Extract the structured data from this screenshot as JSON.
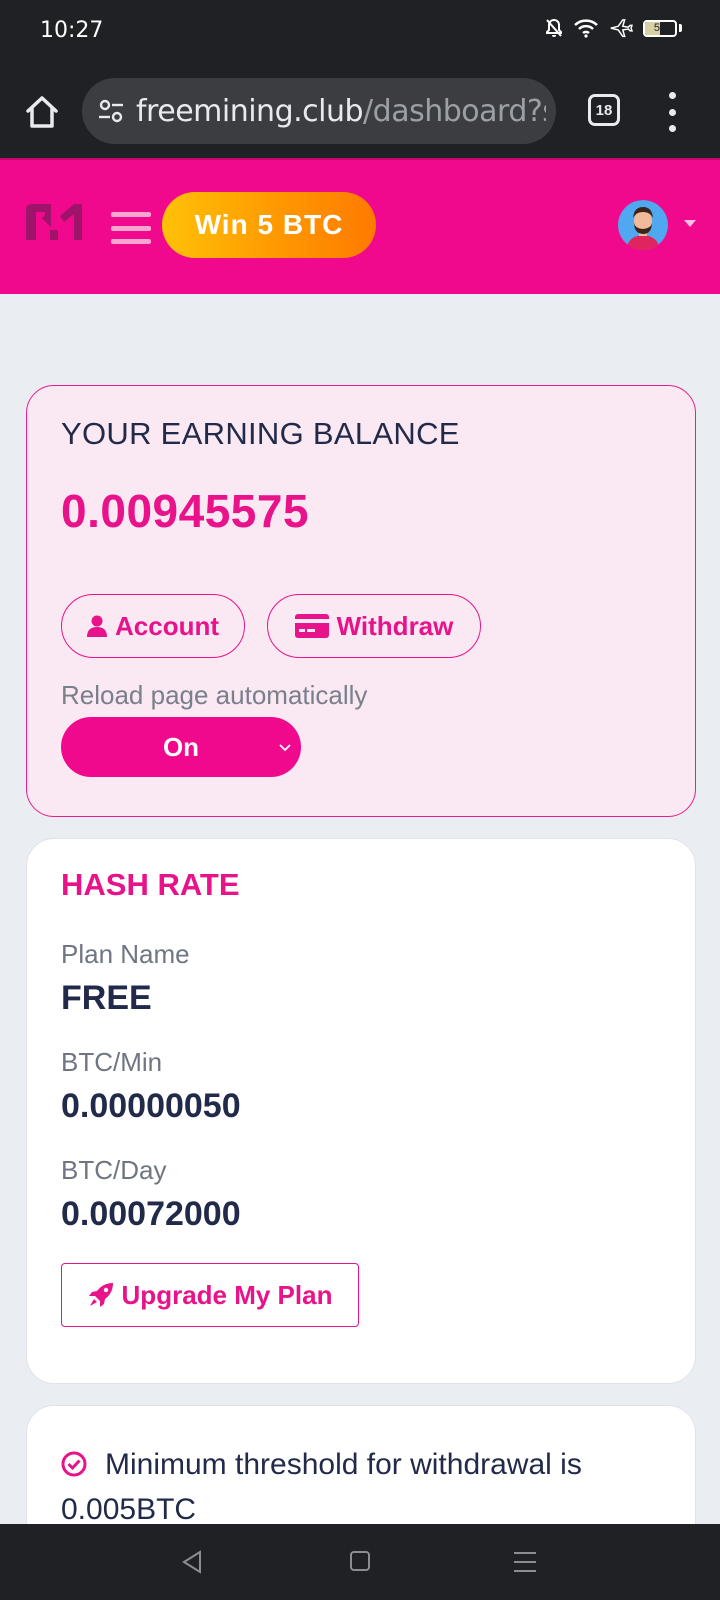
{
  "status_bar": {
    "time": "10:27",
    "battery": "50",
    "icons": [
      "mute-icon",
      "wifi-icon",
      "airplane-icon",
      "battery-icon"
    ]
  },
  "browser": {
    "url_host": "freemining.club",
    "url_path": "/dashboard?s",
    "tab_count": "18"
  },
  "header": {
    "promo_label": "Win 5 BTC",
    "brand_color": "#f0098c",
    "promo_gradient": [
      "#ffc107",
      "#ff7a00"
    ]
  },
  "balance": {
    "title": "YOUR EARNING BALANCE",
    "value": "0.00945575",
    "account_label": "Account",
    "withdraw_label": "Withdraw",
    "reload_label": "Reload page automatically",
    "reload_value": "On"
  },
  "hash_rate": {
    "title": "HASH RATE",
    "plan_label": "Plan Name",
    "plan_value": "FREE",
    "btc_min_label": "BTC/Min",
    "btc_min_value": "0.00000050",
    "btc_day_label": "BTC/Day",
    "btc_day_value": "0.00072000",
    "upgrade_label": "Upgrade My Plan"
  },
  "info": {
    "threshold_text": "Minimum threshold for withdrawal is 0.005BTC"
  },
  "colors": {
    "accent": "#e8128a",
    "text_dark": "#222a4a",
    "page_bg": "#eaedf2"
  }
}
